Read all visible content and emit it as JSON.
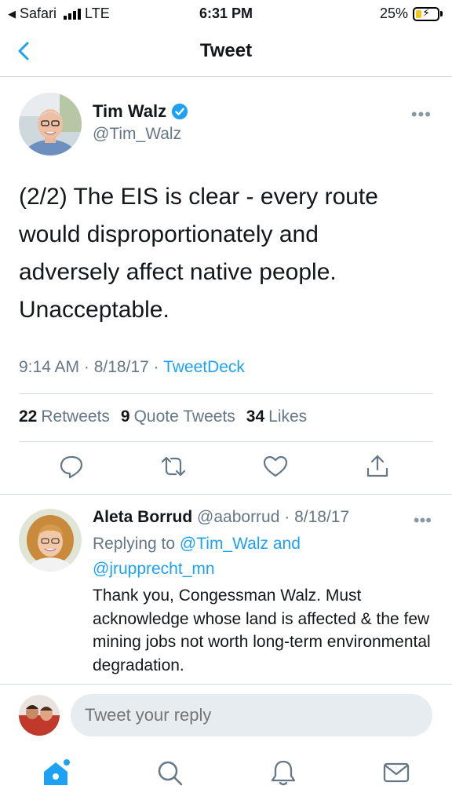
{
  "status_bar": {
    "carrier": "Safari",
    "network": "LTE",
    "time": "6:31 PM",
    "battery_percent": "25%",
    "battery_level": 0.25,
    "charging": true
  },
  "nav": {
    "title": "Tweet",
    "back_icon": "chevron-left-icon"
  },
  "tweet": {
    "author_name": "Tim Walz",
    "author_handle": "@Tim_Walz",
    "verified": true,
    "text": "(2/2) The EIS is clear - every route\nwould disproportionately and\nadversely affect native people.\nUnacceptable.",
    "timestamp": "9:14 AM · 8/18/17 · ",
    "source": "TweetDeck",
    "stats": {
      "retweets_count": "22",
      "retweets_label": "Retweets",
      "quotes_count": "9",
      "quotes_label": "Quote Tweets",
      "likes_count": "34",
      "likes_label": "Likes"
    },
    "actions": [
      "reply-icon",
      "retweet-icon",
      "like-icon",
      "share-icon"
    ]
  },
  "reply": {
    "author_name": "Aleta Borrud",
    "author_handle": "@aaborrud · 8/18/17",
    "replying_prefix": "Replying to ",
    "replying_mention_1": "@Tim_Walz",
    "replying_and": " and",
    "replying_mention_2": "@jrupprecht_mn",
    "text": "Thank you, Congessman Walz.  Must acknowledge whose land is affected & the few mining jobs not worth long-term environmental degradation."
  },
  "composer": {
    "placeholder": "Tweet your reply"
  },
  "tabbar": {
    "tabs": [
      "home-icon",
      "search-icon",
      "notifications-icon",
      "messages-icon"
    ],
    "active_tab": "home-icon",
    "accent": "#1da1f2"
  },
  "colors": {
    "accent": "#1da1f2",
    "secondary_text": "#657786",
    "divider": "#d6dbdf"
  }
}
